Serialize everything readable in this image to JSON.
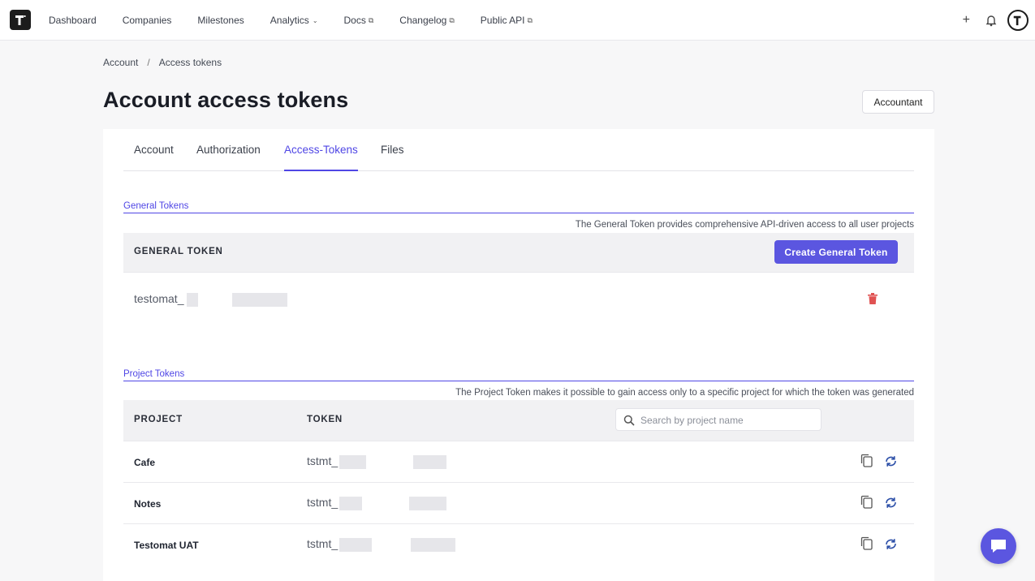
{
  "nav": {
    "items": [
      {
        "label": "Dashboard",
        "suffix": ""
      },
      {
        "label": "Companies",
        "suffix": ""
      },
      {
        "label": "Milestones",
        "suffix": ""
      },
      {
        "label": "Analytics",
        "suffix": "dropdown"
      },
      {
        "label": "Docs",
        "suffix": "external"
      },
      {
        "label": "Changelog",
        "suffix": "external"
      },
      {
        "label": "Public API",
        "suffix": "external"
      }
    ],
    "plus_label": "+"
  },
  "breadcrumb": {
    "root": "Account",
    "separator": "/",
    "current": "Access tokens"
  },
  "header": {
    "title": "Account access tokens",
    "role_button": "Accountant"
  },
  "tabs": [
    {
      "label": "Account",
      "active": false
    },
    {
      "label": "Authorization",
      "active": false
    },
    {
      "label": "Access-Tokens",
      "active": true
    },
    {
      "label": "Files",
      "active": false
    }
  ],
  "general": {
    "section_title": "General Tokens",
    "description": "The General Token provides comprehensive API-driven access to all user projects",
    "column_header": "GENERAL TOKEN",
    "create_button": "Create General Token",
    "token_prefix": "testomat_"
  },
  "project": {
    "section_title": "Project Tokens",
    "description": "The Project Token makes it possible to gain access only to a specific project for which the token was generated",
    "columns": {
      "project": "PROJECT",
      "token": "TOKEN"
    },
    "search_placeholder": "Search by project name",
    "rows": [
      {
        "name": "Cafe",
        "token_prefix": "tstmt_"
      },
      {
        "name": "Notes",
        "token_prefix": "tstmt_"
      },
      {
        "name": "Testomat UAT",
        "token_prefix": "tstmt_"
      }
    ]
  },
  "colors": {
    "accent": "#4f46e5",
    "primary_button": "#5b56e0",
    "danger": "#e05252",
    "refresh": "#2c4fa8"
  },
  "icons": [
    "logo-icon",
    "plus-icon",
    "bell-icon",
    "avatar-icon",
    "external-link-icon",
    "chevron-down-icon",
    "trash-icon",
    "search-icon",
    "copy-icon",
    "refresh-icon",
    "chat-icon"
  ]
}
